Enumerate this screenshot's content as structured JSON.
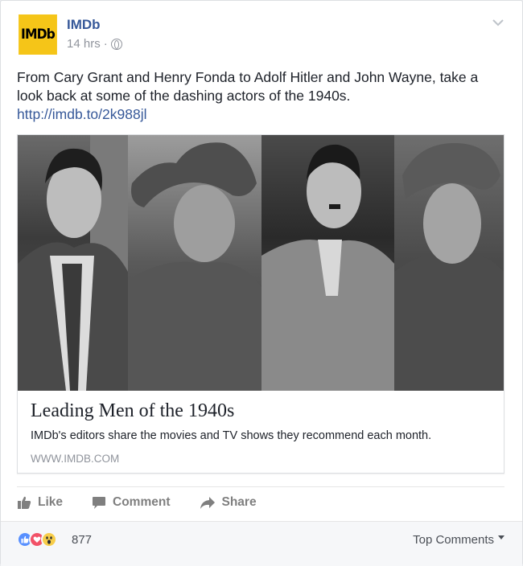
{
  "post": {
    "page_name": "IMDb",
    "avatar_text": "IMDb",
    "timestamp": "14 hrs",
    "separator": "·",
    "audience_icon": "globe-icon",
    "menu_icon": "chevron-down-icon",
    "text": "From Cary Grant and Henry Fonda to Adolf Hitler and John Wayne, take a look back at some of the dashing actors of the 1940s.",
    "link": "http://imdb.to/2k988jl"
  },
  "link_card": {
    "photos": [
      "portrait-photo-1",
      "portrait-photo-2",
      "portrait-photo-3",
      "portrait-photo-4"
    ],
    "title": "Leading Men of the 1940s",
    "description": "IMDb's editors share the movies and TV shows they recommend each month.",
    "domain": "WWW.IMDB.COM"
  },
  "actions": {
    "like_label": "Like",
    "comment_label": "Comment",
    "share_label": "Share"
  },
  "reactions": {
    "icons": [
      "like-reaction-icon",
      "love-reaction-icon",
      "wow-reaction-icon"
    ],
    "count": "877",
    "top_comments_label": "Top Comments"
  },
  "colors": {
    "link_blue": "#365899",
    "imdb_yellow": "#f5c518",
    "meta_gray": "#90949c"
  }
}
